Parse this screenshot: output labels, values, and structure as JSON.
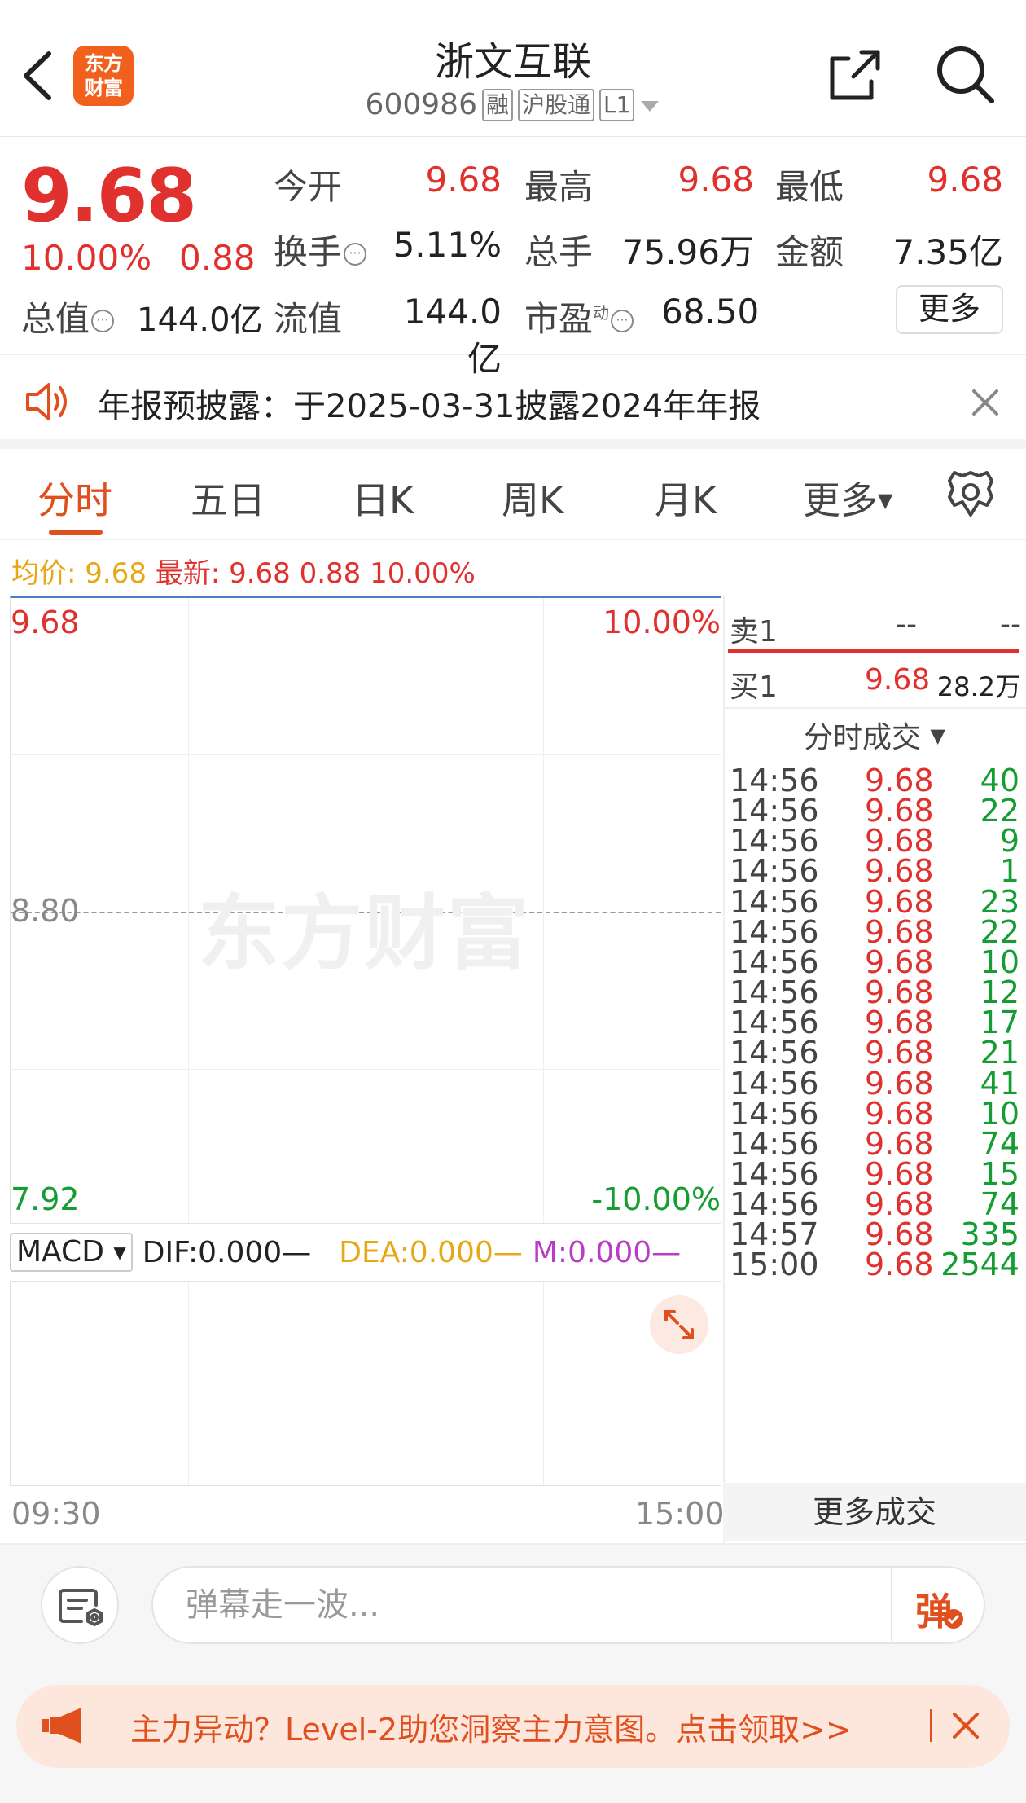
{
  "header": {
    "logo_line1": "东方",
    "logo_line2": "财富",
    "title": "浙文互联",
    "code": "600986",
    "tags": [
      "融",
      "沪股通",
      "L1"
    ]
  },
  "quote": {
    "price": "9.68",
    "change_pct": "10.00%",
    "change": "0.88",
    "fields": {
      "open_label": "今开",
      "open": "9.68",
      "high_label": "最高",
      "high": "9.68",
      "low_label": "最低",
      "low": "9.68",
      "turnover_label": "换手",
      "turnover": "5.11%",
      "volume_label": "总手",
      "volume": "75.96万",
      "amount_label": "金额",
      "amount": "7.35亿",
      "mktcap_label": "总值",
      "mktcap": "144.0亿",
      "float_label": "流值",
      "float": "144.0亿",
      "pe_label": "市盈",
      "pe_sup": "动",
      "pe": "68.50"
    },
    "more_label": "更多"
  },
  "notice": {
    "text": "年报预披露：于2025-03-31披露2024年年报"
  },
  "tabs": [
    {
      "label": "分时"
    },
    {
      "label": "五日"
    },
    {
      "label": "日K"
    },
    {
      "label": "周K"
    },
    {
      "label": "月K"
    },
    {
      "label": "更多"
    }
  ],
  "avg_row": {
    "avg_label": "均价:",
    "avg": "9.68",
    "latest_label": "最新:",
    "latest": "9.68",
    "chg": "0.88",
    "pct": "10.00%"
  },
  "chart": {
    "watermark": "东方财富",
    "y_top": "9.68",
    "y_mid": "8.80",
    "y_bottom": "7.92",
    "pct_top": "10.00%",
    "pct_bottom": "-10.00%",
    "time_start": "09:30",
    "time_end": "15:00"
  },
  "macd": {
    "selector": "MACD",
    "dif": "DIF:0.000",
    "dea": "DEA:0.000",
    "m": "M:0.000",
    "dash": "—"
  },
  "orderbook": {
    "sell_label": "卖1",
    "sell_price": "--",
    "sell_vol": "--",
    "buy_label": "买1",
    "buy_price": "9.68",
    "buy_vol": "28.2万"
  },
  "trades": {
    "title": "分时成交",
    "rows": [
      {
        "time": "14:56",
        "price": "9.68",
        "vol": "40"
      },
      {
        "time": "14:56",
        "price": "9.68",
        "vol": "22"
      },
      {
        "time": "14:56",
        "price": "9.68",
        "vol": "9"
      },
      {
        "time": "14:56",
        "price": "9.68",
        "vol": "1"
      },
      {
        "time": "14:56",
        "price": "9.68",
        "vol": "23"
      },
      {
        "time": "14:56",
        "price": "9.68",
        "vol": "22"
      },
      {
        "time": "14:56",
        "price": "9.68",
        "vol": "10"
      },
      {
        "time": "14:56",
        "price": "9.68",
        "vol": "12"
      },
      {
        "time": "14:56",
        "price": "9.68",
        "vol": "17"
      },
      {
        "time": "14:56",
        "price": "9.68",
        "vol": "21"
      },
      {
        "time": "14:56",
        "price": "9.68",
        "vol": "41"
      },
      {
        "time": "14:56",
        "price": "9.68",
        "vol": "10"
      },
      {
        "time": "14:56",
        "price": "9.68",
        "vol": "74"
      },
      {
        "time": "14:56",
        "price": "9.68",
        "vol": "15"
      },
      {
        "time": "14:56",
        "price": "9.68",
        "vol": "74"
      },
      {
        "time": "14:57",
        "price": "9.68",
        "vol": "335"
      },
      {
        "time": "15:00",
        "price": "9.68",
        "vol": "2544"
      }
    ],
    "more_label": "更多成交"
  },
  "bottom": {
    "danmu_placeholder": "弹幕走一波...",
    "danmu_send": "弹",
    "banner_text": "主力异动？Level-2助您洞察主力意图。点击领取>>"
  },
  "colors": {
    "up": "#e0312e",
    "down": "#159d33",
    "accent": "#e0501e",
    "avg": "#e6a817",
    "macd_m": "#b83cc6"
  }
}
